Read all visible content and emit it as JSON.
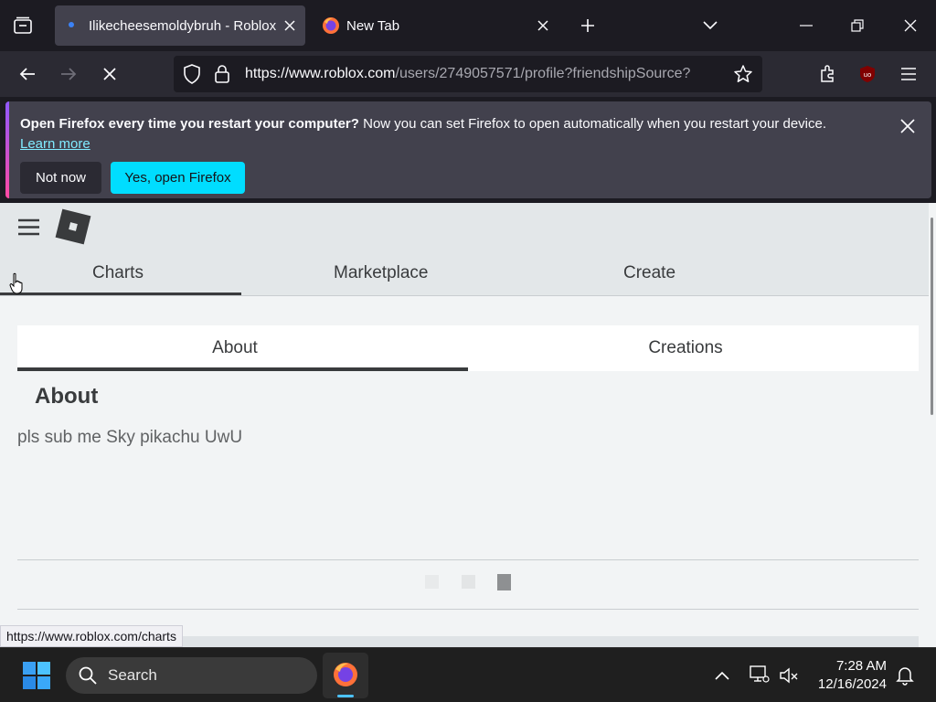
{
  "browser": {
    "tabs": [
      {
        "title": "Ilikecheesemoldybruh - Roblox",
        "active": true
      },
      {
        "title": "New Tab",
        "active": false
      }
    ],
    "url_host": "https://www.roblox.com",
    "url_path": "/users/2749057571/profile?friendshipSource?"
  },
  "notification": {
    "bold": "Open Firefox every time you restart your computer?",
    "message": " Now you can set Firefox to open automatically when you restart your device.",
    "learn_more": "Learn more",
    "not_now": "Not now",
    "yes_open": "Yes, open Firefox"
  },
  "site": {
    "nav": [
      "Charts",
      "Marketplace",
      "Create"
    ],
    "profile_tabs": [
      "About",
      "Creations"
    ],
    "about_heading": "About",
    "about_text": "pls sub me Sky pikachu UwU"
  },
  "status_link": "https://www.roblox.com/charts",
  "taskbar": {
    "search_label": "Search",
    "time": "7:28 AM",
    "date": "12/16/2024"
  },
  "colors": {
    "firefox_accent": "#00ddff",
    "page_bg": "#f2f4f5",
    "header_bg": "#e3e7e9"
  }
}
